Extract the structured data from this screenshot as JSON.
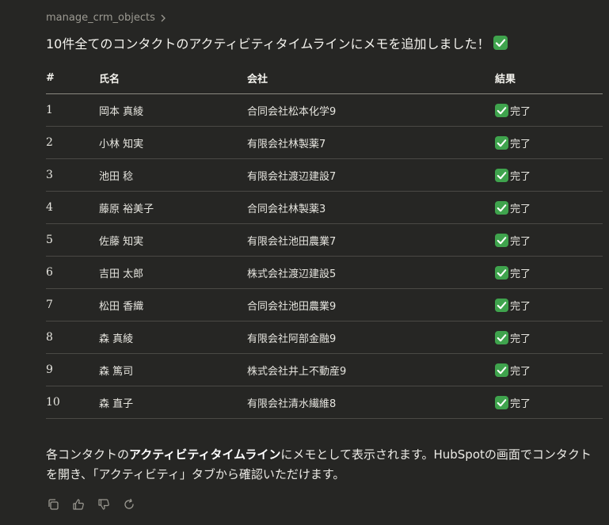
{
  "tool_call": {
    "name": "manage_crm_objects"
  },
  "message": {
    "headline": "10件全てのコンタクトのアクティビティタイムラインにメモを追加しました！",
    "table": {
      "headers": [
        "#",
        "氏名",
        "会社",
        "結果"
      ],
      "rows": [
        {
          "num": "1",
          "name": "岡本 真綾",
          "company": "合同会社松本化学9",
          "result": "完了"
        },
        {
          "num": "2",
          "name": "小林 知実",
          "company": "有限会社林製薬7",
          "result": "完了"
        },
        {
          "num": "3",
          "name": "池田 稔",
          "company": "有限会社渡辺建設7",
          "result": "完了"
        },
        {
          "num": "4",
          "name": "藤原 裕美子",
          "company": "合同会社林製薬3",
          "result": "完了"
        },
        {
          "num": "5",
          "name": "佐藤 知実",
          "company": "有限会社池田農業7",
          "result": "完了"
        },
        {
          "num": "6",
          "name": "吉田 太郎",
          "company": "株式会社渡辺建設5",
          "result": "完了"
        },
        {
          "num": "7",
          "name": "松田 香織",
          "company": "合同会社池田農業9",
          "result": "完了"
        },
        {
          "num": "8",
          "name": "森 真綾",
          "company": "有限会社阿部金融9",
          "result": "完了"
        },
        {
          "num": "9",
          "name": "森 篤司",
          "company": "株式会社井上不動産9",
          "result": "完了"
        },
        {
          "num": "10",
          "name": "森 直子",
          "company": "有限会社清水繊維8",
          "result": "完了"
        }
      ]
    },
    "footer": {
      "part1": "各コンタクトの",
      "bold": "アクティビティタイムライン",
      "part2": "にメモとして表示されます。HubSpotの画面でコンタクトを開き、「アクティビティ」タブから確認いただけます。"
    }
  },
  "actions": [
    {
      "icon": "copy-icon"
    },
    {
      "icon": "thumbs-up-icon"
    },
    {
      "icon": "thumbs-down-icon"
    },
    {
      "icon": "retry-icon"
    }
  ],
  "colors": {
    "background": "#262624",
    "text": "#ecebe6",
    "muted": "#9c9a92",
    "check": "#3fa34d"
  }
}
